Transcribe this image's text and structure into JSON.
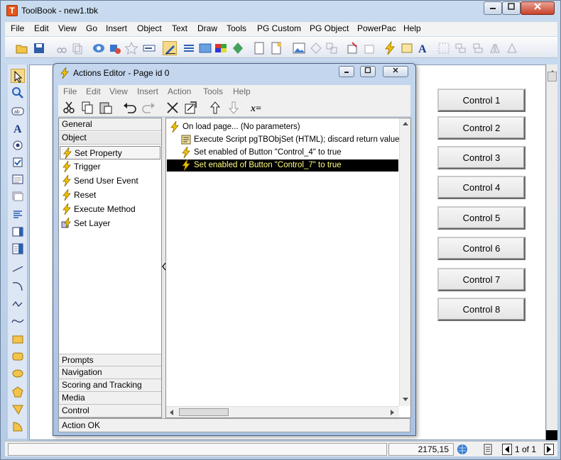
{
  "app": {
    "icon_letter": "T",
    "title": "ToolBook - new1.tbk",
    "min": "0",
    "max": "1",
    "close": "r"
  },
  "menubar": [
    "File",
    "Edit",
    "View",
    "Go",
    "Insert",
    "Object",
    "Text",
    "Draw",
    "Tools",
    "PG Custom",
    "PG Object",
    "PowerPac",
    "Help"
  ],
  "controls": [
    "Control 1",
    "Control 2",
    "Control 3",
    "Control 4",
    "Control 5",
    "Control 6",
    "Control 7",
    "Control 8"
  ],
  "statusbar": {
    "coords": "2175,15",
    "page": "1 of 1"
  },
  "actions_editor": {
    "title": "Actions Editor - Page id 0",
    "menu": [
      "File",
      "Edit",
      "View",
      "Insert",
      "Action",
      "Tools",
      "Help"
    ],
    "categories_top": [
      "General",
      "Object"
    ],
    "actions": [
      "Set Property",
      "Trigger",
      "Send User Event",
      "Reset",
      "Execute Method",
      "Set Layer"
    ],
    "categories_bottom": [
      "Prompts",
      "Navigation",
      "Scoring and Tracking",
      "Media",
      "Control"
    ],
    "script_lines": [
      "On load page... (No parameters)",
      "Execute Script pgTBObjSet (HTML); discard return value",
      "Set enabled of Button \"Control_4\" to true",
      "Set enabled of Button \"Control_7\" to true"
    ],
    "status": "Action OK",
    "colors": {
      "selected_bg": "#000000",
      "selected_fg": "#ffff80",
      "bolt": "#f5c400"
    }
  }
}
